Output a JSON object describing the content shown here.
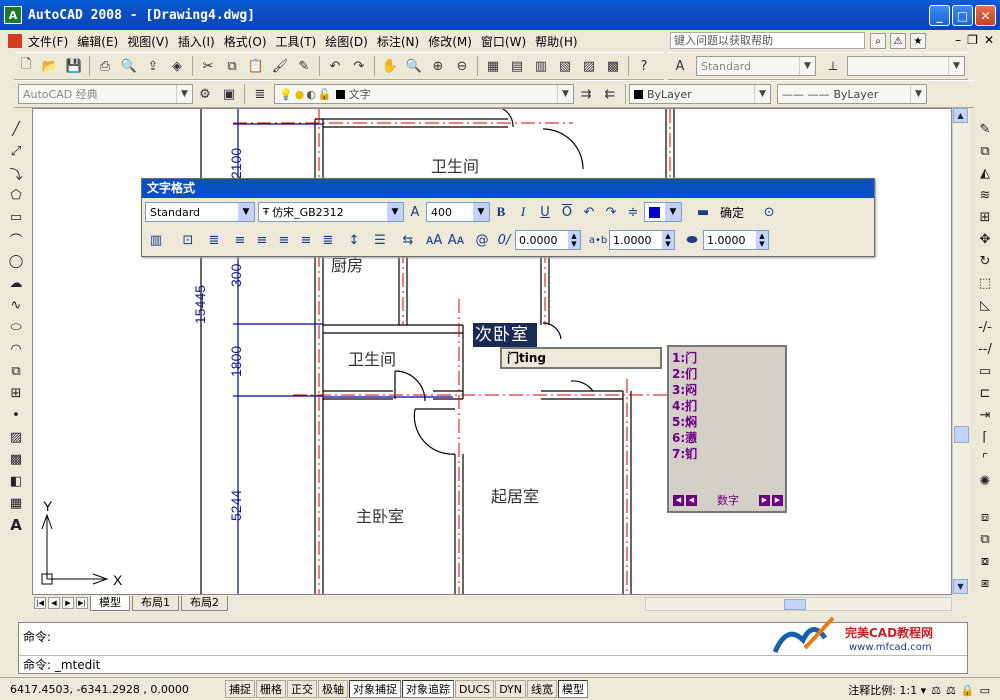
{
  "window": {
    "title": "AutoCAD 2008 - [Drawing4.dwg]",
    "app_icon": "A"
  },
  "menu": {
    "items": [
      "文件(F)",
      "编辑(E)",
      "视图(V)",
      "插入(I)",
      "格式(O)",
      "工具(T)",
      "绘图(D)",
      "标注(N)",
      "修改(M)",
      "窗口(W)",
      "帮助(H)"
    ],
    "help_placeholder": "键入问题以获取帮助"
  },
  "toolbar_styles": {
    "text_style": "Standard"
  },
  "toolbar_workspace": {
    "workspace": "AutoCAD 经典",
    "layer_name": "文字",
    "color": "ByLayer",
    "linetype": "ByLayer"
  },
  "text_format": {
    "title": "文字格式",
    "style": "Standard",
    "font": "仿宋_GB2312",
    "height": "400",
    "bold": "B",
    "italic": "I",
    "underline": "U",
    "overline": "O",
    "ok_label": "确定",
    "oblique": "0.0000",
    "tracking": "1.0000",
    "width": "1.0000",
    "accent_color": "#0000cc"
  },
  "drawing": {
    "dims": [
      "2100",
      "300",
      "15445",
      "1800",
      "5244"
    ],
    "rooms": [
      "卫生间",
      "厨房",
      "卫生间",
      "主卧室",
      "起居室"
    ],
    "editing_text": "次卧室",
    "axis_x": "X",
    "axis_y": "Y"
  },
  "ime": {
    "input": "门ting",
    "candidates": [
      "1:门",
      "2:们",
      "3:闷",
      "4:扪",
      "5:焖",
      "6:懑",
      "7:钔"
    ],
    "footer_label": "数字"
  },
  "layout_tabs": [
    "模型",
    "布局1",
    "布局2"
  ],
  "command": {
    "line1": "命令:",
    "line2": "命令: _mtedit"
  },
  "watermark": {
    "brand": "完美CAD教程网",
    "url": "www.mfcad.com"
  },
  "status": {
    "coords": "6417.4503, -6341.2928 , 0.0000",
    "buttons": [
      "捕捉",
      "栅格",
      "正交",
      "极轴",
      "对象捕捉",
      "对象追踪",
      "DUCS",
      "DYN",
      "线宽",
      "模型"
    ],
    "annotation_scale": "注释比例: 1:1 ▾"
  }
}
